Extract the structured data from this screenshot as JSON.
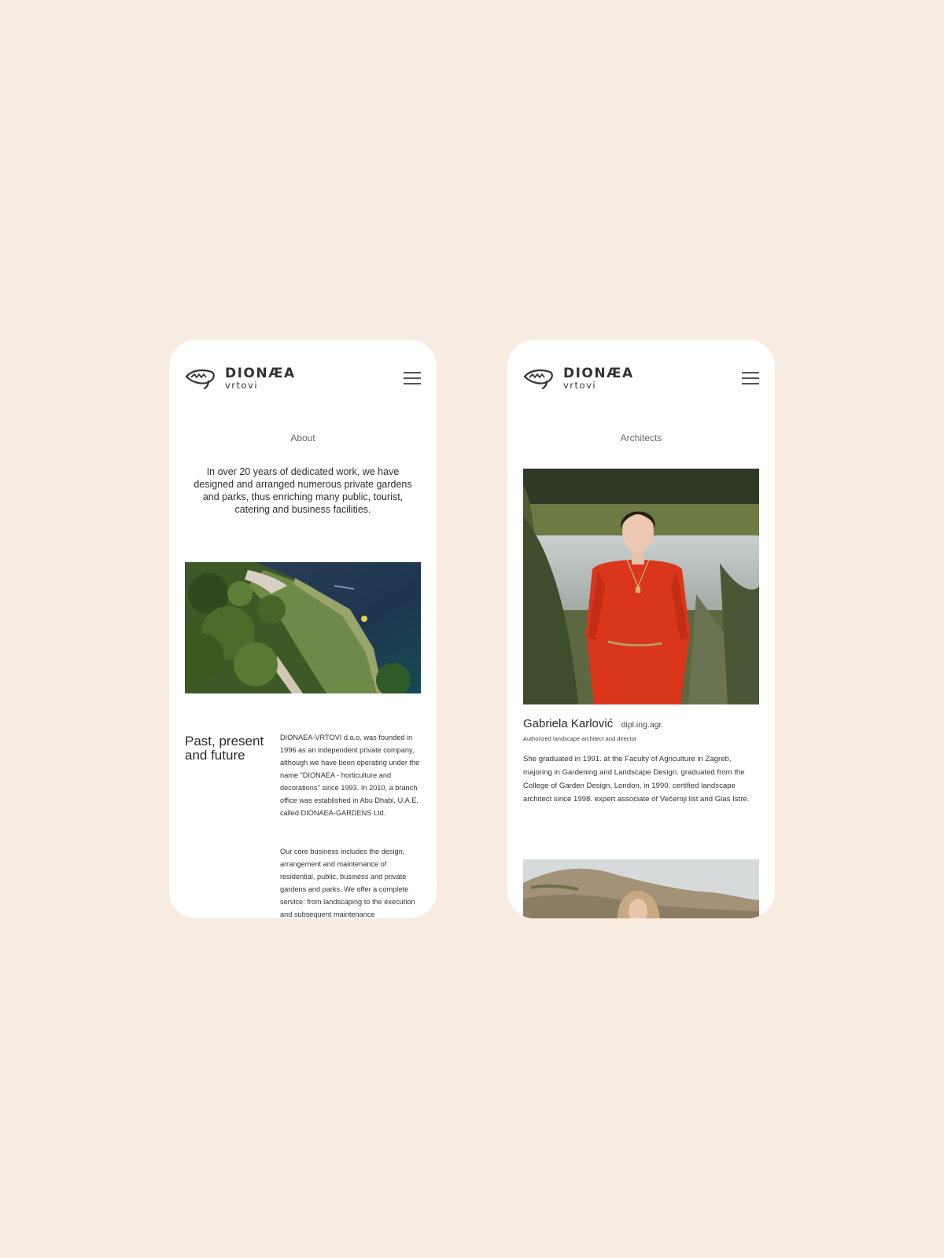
{
  "brand": {
    "name": "DIONÆA",
    "subtitle": "vrtovi"
  },
  "about_screen": {
    "page_title": "About",
    "intro": "In over 20 years of dedicated work, we have designed and arranged numerous private gardens and parks, thus enriching many public, tourist, catering and business facilities.",
    "section_heading": "Past, present and future",
    "paragraph_1": "DIONAEA-VRTOVI d.o.o. was founded in 1996 as an independent private company, although we have been operating under the name \"DIONAEA - horticulture and decorations\" since 1993. In 2010, a branch office was established in Abu Dhabi, U.A.E. called DIONAEA-GARDENS Ltd.",
    "paragraph_2": "Our core business includes the design, arrangement and maintenance of residential, public, business and private gardens and parks. We offer a complete service: from landscaping to the execution and subsequent maintenance"
  },
  "architects_screen": {
    "page_title": "Architects",
    "architect": {
      "name": "Gabriela Karlović",
      "degree": "dipl.ing.agr.",
      "role": "Authorized landscape architect and director",
      "bio": "She graduated in 1991. at the Faculty of Agriculture in Zagreb, majoring in Gardening and Landscape Design. graduated from the College of Garden Design, London, in 1990. certified landscape architect since 1998. expert associate of Večernji list and Glas Istre."
    }
  },
  "icons": {
    "logo": "dionaea-logo-icon",
    "menu": "hamburger-menu-icon"
  },
  "colors": {
    "background": "#f7ebe2",
    "screen": "#ffffff",
    "text": "#2b2b2b",
    "dress_red": "#d9361c"
  }
}
